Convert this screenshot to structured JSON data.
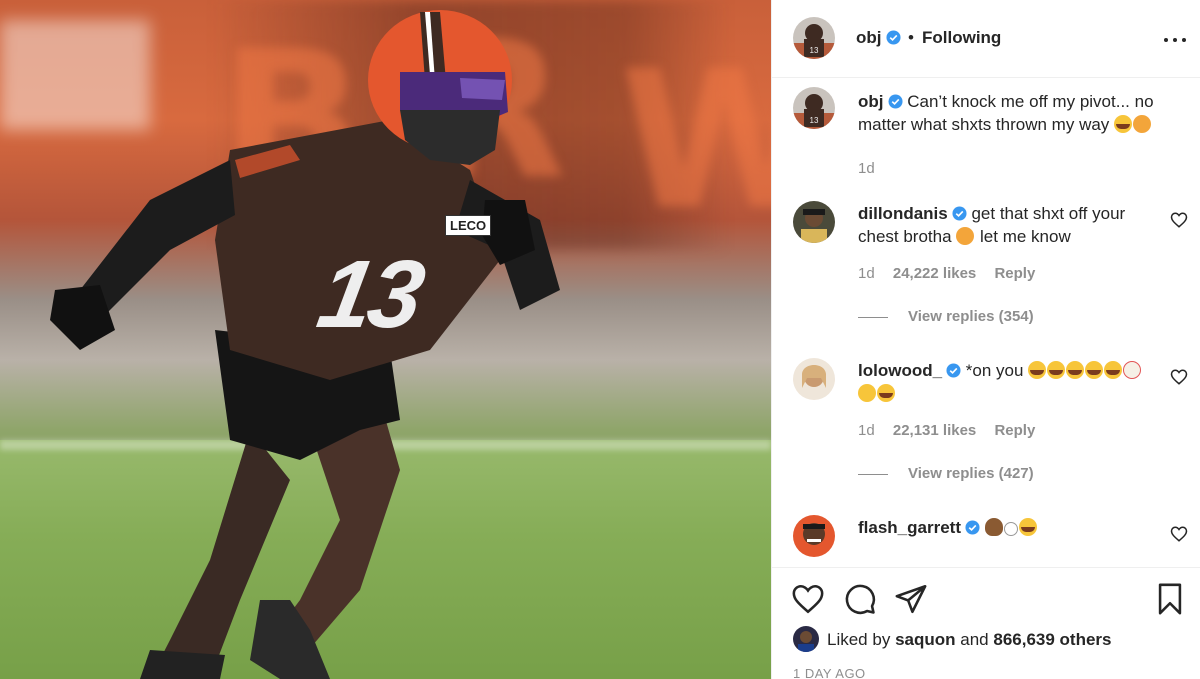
{
  "post": {
    "jersey_number": "13",
    "jersey_patch": "LECO"
  },
  "header": {
    "username": "obj",
    "separator": "•",
    "follow_status": "Following"
  },
  "caption": {
    "username": "obj",
    "text": "Can’t knock me off my pivot... no matter what shxts thrown my way",
    "time": "1d"
  },
  "comments": [
    {
      "username": "dillondanis",
      "text_a": "get that shxt off your chest brotha",
      "text_b": "let me know",
      "time": "1d",
      "likes": "24,222 likes",
      "reply_label": "Reply",
      "view_replies": "View replies (354)"
    },
    {
      "username": "lolowood_",
      "text_a": "*on you",
      "time": "1d",
      "likes": "22,131 likes",
      "reply_label": "Reply",
      "view_replies": "View replies (427)"
    },
    {
      "username": "flash_garrett"
    }
  ],
  "likes": {
    "prefix": "Liked by",
    "user": "saquon",
    "and": "and",
    "count": "866,639 others"
  },
  "timestamp": "1 DAY AGO",
  "icons": [
    "verified-badge-icon",
    "more-icon",
    "heart-icon",
    "comment-icon",
    "share-icon",
    "bookmark-icon"
  ],
  "colors": {
    "verified": "#3897f0",
    "text": "#262626",
    "muted": "#8e8e8e",
    "browns_orange": "#e4572e",
    "browns_brown": "#3e2a22"
  }
}
